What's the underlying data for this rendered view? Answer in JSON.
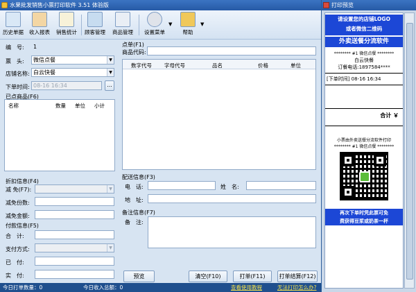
{
  "window": {
    "title": "水果批发销售小票打印软件 3.51 体验版",
    "preview_title": "打印预览"
  },
  "toolbar": {
    "items": [
      {
        "label": "历史单据",
        "icon": "history-icon"
      },
      {
        "label": "收入报表",
        "icon": "income-report-icon"
      },
      {
        "label": "销售统计",
        "icon": "sales-stats-icon"
      },
      {
        "label": "顾客管理",
        "icon": "customer-icon"
      },
      {
        "label": "商品管理",
        "icon": "product-icon"
      },
      {
        "label": "设置菜单",
        "icon": "settings-icon"
      },
      {
        "label": "帮助",
        "icon": "help-icon"
      }
    ],
    "dropdown_glyph": "▼"
  },
  "form": {
    "number_label": "编　号:",
    "number_value": "1",
    "header_label": "票　头:",
    "header_value": "微信点餐",
    "shop_label": "店铺名称:",
    "shop_value": "白云快餐",
    "time_label": "下单时间:",
    "time_value": "08-16 16:34",
    "time_button": "..."
  },
  "selected": {
    "title": "已点商品(F6)",
    "columns": [
      "名称",
      "数量",
      "单位",
      "小计"
    ]
  },
  "discount": {
    "title": "折扣信息(F4)",
    "reduce_type_label": "减 免(F7):",
    "reduce_count_label": "减免份数:",
    "reduce_amount_label": "减免金额:"
  },
  "payment": {
    "title": "付款信息(F5)",
    "total_label": "合　计:",
    "method_label": "支付方式:",
    "paid_label": "已　付:",
    "actual_label": "实　付:"
  },
  "order": {
    "title": "点单(F1)",
    "code_label": "商品代码:",
    "columns": [
      "数字代号",
      "字母代号",
      "品名",
      "价格",
      "单位"
    ]
  },
  "delivery": {
    "title": "配送信息(F3)",
    "phone_label": "电　话:",
    "name_label": "姓　名:",
    "address_label": "地　址:"
  },
  "remarks": {
    "title": "备注信息(F7)",
    "note_label": "备　注:"
  },
  "buttons": {
    "preview": "预览",
    "clear": "清空(F10)",
    "print": "打单(F11)",
    "print_settle": "打单结算(F12)"
  },
  "status": {
    "today_print": "今日打单数量：0",
    "today_income": "今日收入总额：0",
    "tutorial_link": "查看使用教程",
    "cannot_print_link": "无法打印怎么办?"
  },
  "receipt": {
    "logo_text_1": "请设置您的店铺LOGO",
    "logo_text_2": "或者微信二维码",
    "headline": "外卖送餐分流软件",
    "order_line": "******** #1 微信点餐 ********",
    "shop": "白云快餐",
    "phone": "订餐电话:1897584****",
    "order_time": "[下单时间] 08-16 16:34",
    "col_name": "品名",
    "col_qty": "数量",
    "col_subtotal": "小计",
    "total": "合计 ￥",
    "slogan": "小票由外卖送餐分流软件打印",
    "order_line_2": "******** #1 微信点餐 ********",
    "footer_1": "再次下单时凭此票可免",
    "footer_2": "费获得豆浆或奶茶一杯"
  },
  "colors": {
    "title_bar": "#2e66b5",
    "banner_blue": "#1c47d6",
    "status_link": "#f6e24b"
  }
}
